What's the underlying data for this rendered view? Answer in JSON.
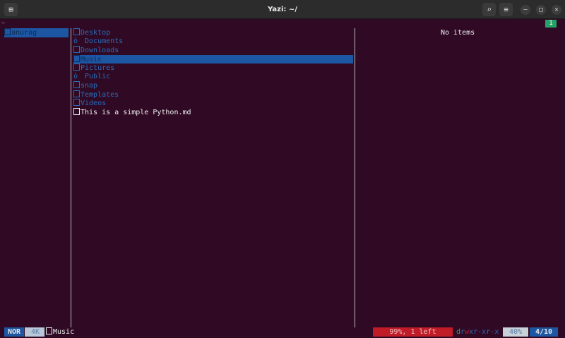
{
  "window": {
    "title": "Yazi: ~/"
  },
  "header": {
    "cwd": "~",
    "tab": "1"
  },
  "parent": {
    "items": [
      {
        "name": "anurag",
        "selected": true
      }
    ]
  },
  "current": {
    "items": [
      {
        "name": "Desktop",
        "type": "dir"
      },
      {
        "name": "Documents",
        "type": "dir-special",
        "glyph": "ò"
      },
      {
        "name": "Downloads",
        "type": "dir"
      },
      {
        "name": "Music",
        "type": "dir",
        "selected": true
      },
      {
        "name": "Pictures",
        "type": "dir"
      },
      {
        "name": "Public",
        "type": "dir-special",
        "glyph": "ò"
      },
      {
        "name": "snap",
        "type": "dir"
      },
      {
        "name": "Templates",
        "type": "dir"
      },
      {
        "name": "Videos",
        "type": "dir"
      },
      {
        "name": "This is a simple Python.md",
        "type": "file"
      }
    ]
  },
  "preview": {
    "text": "No items"
  },
  "statusbar": {
    "mode": "NOR",
    "size": "4K",
    "name": "Music",
    "progress": "99%, 1 left",
    "perm_d": "d",
    "perm_r": "r",
    "perm_w": "w",
    "perm_rest": "xr-xr-x",
    "percent": "40%",
    "position": "4/10"
  }
}
